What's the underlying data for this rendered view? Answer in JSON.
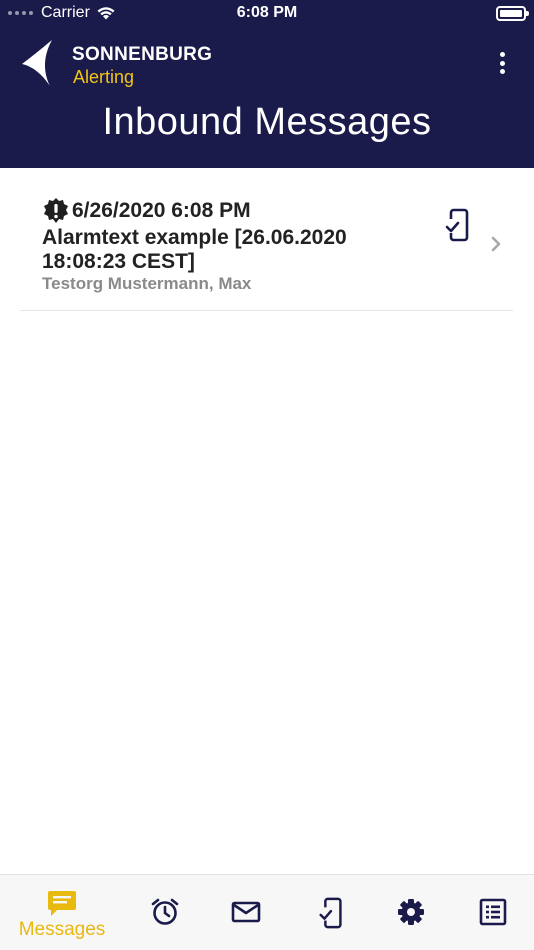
{
  "status_bar": {
    "carrier": "Carrier",
    "time": "6:08 PM"
  },
  "header": {
    "brand_name": "SONNENBURG",
    "brand_sub": "Alerting",
    "title": "Inbound Messages"
  },
  "messages": [
    {
      "date": "6/26/2020 6:08 PM",
      "text": "Alarmtext example [26.06.2020 18:08:23 CEST]",
      "sender": "Testorg Mustermann, Max",
      "alert_icon": "alert-badge-icon",
      "status_icon": "phone-check-icon"
    }
  ],
  "tabbar": {
    "active": "messages",
    "tabs": [
      {
        "id": "messages",
        "label": "Messages",
        "icon": "message-icon"
      },
      {
        "id": "alarm",
        "label": "",
        "icon": "alarm-clock-icon"
      },
      {
        "id": "mail",
        "label": "",
        "icon": "mail-icon"
      },
      {
        "id": "confirm",
        "label": "",
        "icon": "phone-check-icon"
      },
      {
        "id": "settings",
        "label": "",
        "icon": "gear-icon"
      },
      {
        "id": "log",
        "label": "",
        "icon": "list-icon"
      }
    ]
  },
  "colors": {
    "header_bg": "#1a1b4b",
    "accent": "#e8b90f",
    "brand_sub": "#f2c417"
  }
}
